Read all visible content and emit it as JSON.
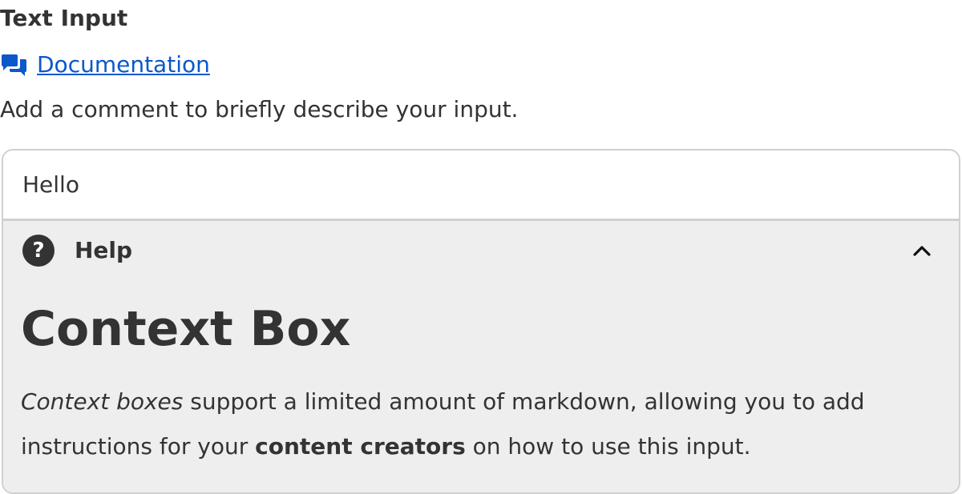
{
  "field": {
    "label": "Text Input",
    "documentation_link": "Documentation",
    "description": "Add a comment to briefly describe your input.",
    "input_value": "Hello"
  },
  "help": {
    "title": "Help",
    "icon": "question-circle-icon",
    "toggle_icon": "chevron-up-icon",
    "expanded": true,
    "context_heading": "Context Box",
    "body": {
      "part1_em": "Context boxes",
      "part2": " support a limited amount of markdown, allowing you to add instructions for your ",
      "part3_strong": "content creators",
      "part4": " on how to use this input."
    }
  },
  "colors": {
    "link": "#0a58ca",
    "text": "#333333",
    "border": "#d0d0d0",
    "help_background": "#eeeeee"
  },
  "icons": {
    "documentation": "comments-icon"
  }
}
